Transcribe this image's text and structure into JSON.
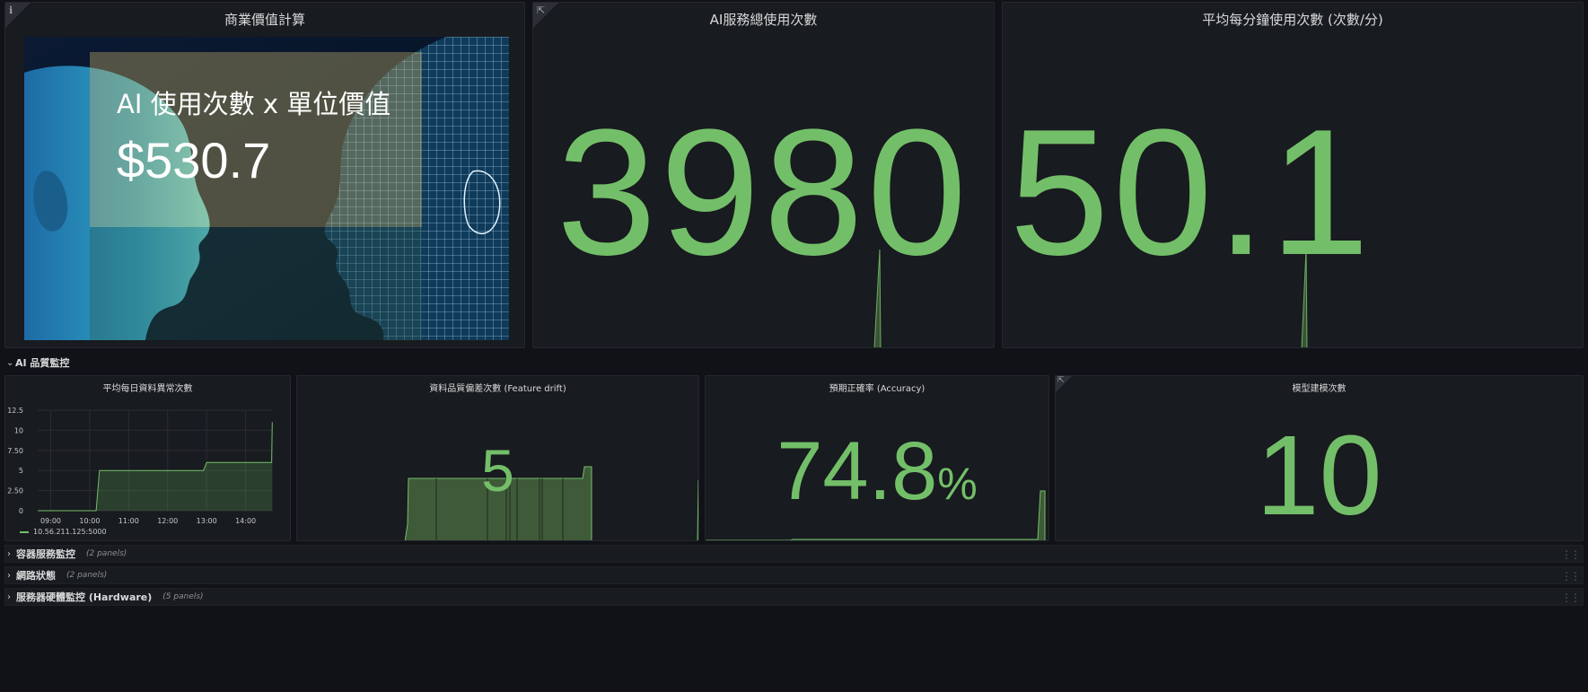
{
  "panels": {
    "business_value": {
      "title": "商業價值計算",
      "overlay_title": "AI 使用次數 x 單位價值",
      "overlay_value": "$530.7"
    },
    "total_usage": {
      "title": "AI服務總使用次數",
      "value": "3980"
    },
    "avg_per_minute": {
      "title": "平均每分鐘使用次數 (次數/分)",
      "value": "50.1"
    }
  },
  "row_ai_quality": {
    "label": "AI 品質監控"
  },
  "quality_panels": {
    "daily_anomaly": {
      "title": "平均每日資料異常次數",
      "legend": "10.56.211.125:5000"
    },
    "feature_drift": {
      "title": "資料品質偏差次數 (Feature drift)",
      "value": "5"
    },
    "accuracy": {
      "title": "預期正確率 (Accuracy)",
      "value": "74.8",
      "unit": "%"
    },
    "model_builds": {
      "title": "模型建模次數",
      "value": "10"
    }
  },
  "collapsed_rows": [
    {
      "title": "容器服務監控",
      "count": "(2 panels)"
    },
    {
      "title": "網路狀態",
      "count": "(2 panels)"
    },
    {
      "title": "服務器硬體監控 (Hardware)",
      "count": "(5 panels)"
    }
  ],
  "chart_data": {
    "type": "line",
    "title": "平均每日資料異常次數",
    "x": [
      "08:40",
      "10:10",
      "10:15",
      "12:55",
      "13:00",
      "14:40",
      "14:41"
    ],
    "series": [
      {
        "name": "10.56.211.125:5000",
        "values": [
          0,
          0,
          5,
          5,
          6,
          6,
          11
        ]
      }
    ],
    "x_ticks": [
      "09:00",
      "10:00",
      "11:00",
      "12:00",
      "13:00",
      "14:00"
    ],
    "y_ticks": [
      "0",
      "2.50",
      "5",
      "7.50",
      "10",
      "12.5"
    ],
    "ylim": [
      0,
      12.5
    ],
    "grid": true,
    "legend": "bottom-left",
    "color": "#73bf69"
  },
  "colors": {
    "value_green": "#73bf69",
    "panel_bg": "#181b1f",
    "page_bg": "#111217"
  }
}
